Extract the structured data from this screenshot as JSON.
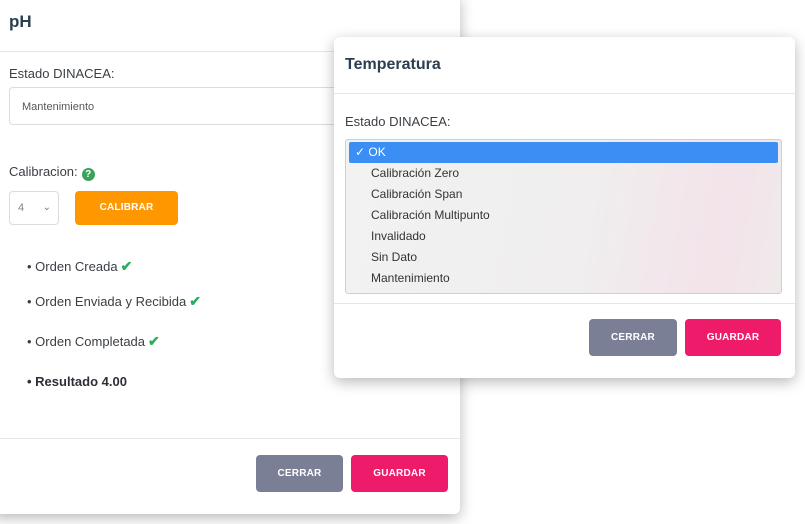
{
  "ph_panel": {
    "title": "pH",
    "estado_label": "Estado DINACEA:",
    "estado_value": "Mantenimiento",
    "calibracion_label": "Calibracion:",
    "calibracion_select_value": "4",
    "calibrar_button": "CALIBRAR",
    "steps": [
      {
        "text": "Orden Creada",
        "done": true
      },
      {
        "text": "Orden Enviada y Recibida",
        "done": true
      },
      {
        "text": "Orden Completada",
        "done": true
      }
    ],
    "resultado": "Resultado 4.00",
    "cerrar_button": "CERRAR",
    "guardar_button": "GUARDAR"
  },
  "temp_panel": {
    "title": "Temperatura",
    "estado_label": "Estado DINACEA:",
    "options": [
      "OK",
      "Calibración Zero",
      "Calibración Span",
      "Calibración Multipunto",
      "Invalidado",
      "Sin Dato",
      "Mantenimiento"
    ],
    "selected_option": "OK",
    "cerrar_button": "CERRAR",
    "guardar_button": "GUARDAR"
  },
  "colors": {
    "orange": "#ff9700",
    "gray_button": "#7b7f96",
    "pink_button": "#ee1a6a",
    "selected_blue": "#3b8ef3",
    "check_green": "#27ae60"
  },
  "icons": {
    "help": "question-circle-icon",
    "check": "checkmark-icon",
    "chevron": "chevron-down-icon"
  }
}
